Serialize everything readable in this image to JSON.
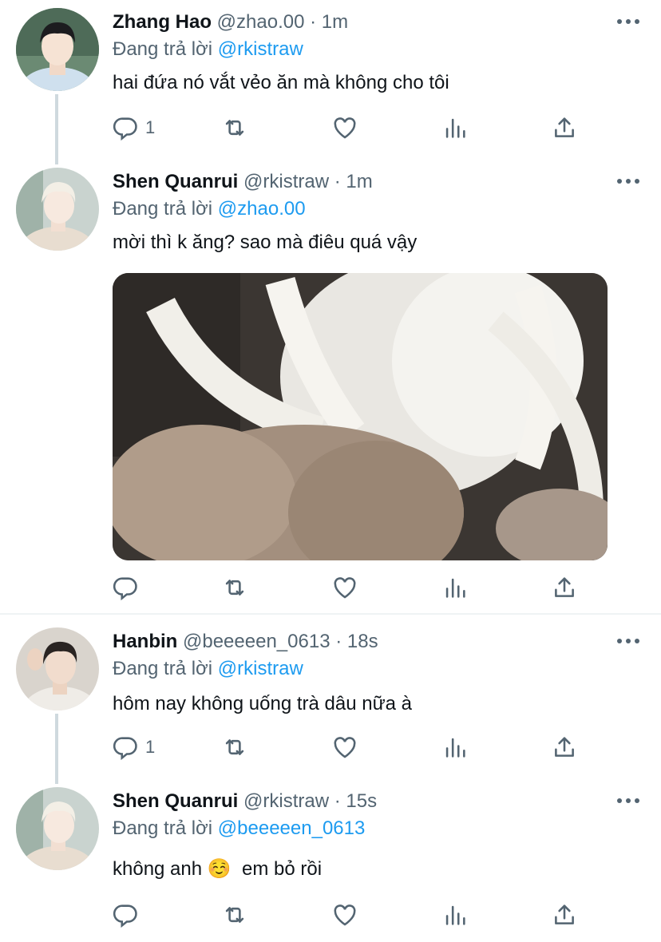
{
  "tweets": [
    {
      "name": "Zhang Hao",
      "handle": "@zhao.00",
      "dot": "·",
      "time": "1m",
      "reply_prefix": "Đang trả lời",
      "reply_to": "@rkistraw",
      "text": "hai đứa nó vắt vẻo ăn mà không cho tôi",
      "reply_count": "1"
    },
    {
      "name": "Shen Quanrui",
      "handle": "@rkistraw",
      "dot": "·",
      "time": "1m",
      "reply_prefix": "Đang trả lời",
      "reply_to": "@zhao.00",
      "text": "mời thì k ăng? sao mà điêu quá vậy",
      "reply_count": ""
    },
    {
      "name": "Hanbin",
      "handle": "@beeeeen_0613",
      "dot": "·",
      "time": "18s",
      "reply_prefix": "Đang trả lời",
      "reply_to": "@rkistraw",
      "text": " hôm nay không uống trà dâu nữa à",
      "reply_count": "1"
    },
    {
      "name": "Shen Quanrui",
      "handle": "@rkistraw",
      "dot": "·",
      "time": "15s",
      "reply_prefix": "Đang trả lời",
      "reply_to": "@beeeeen_0613",
      "text": "không anh ☺️  em bỏ rồi",
      "reply_count": ""
    }
  ],
  "icons": [
    "reply-icon",
    "retweet-icon",
    "like-icon",
    "analytics-icon",
    "share-icon",
    "more-icon"
  ],
  "colors": {
    "link": "#1d9bf0",
    "secondary": "#536471",
    "thread_line": "#cfd9de"
  }
}
